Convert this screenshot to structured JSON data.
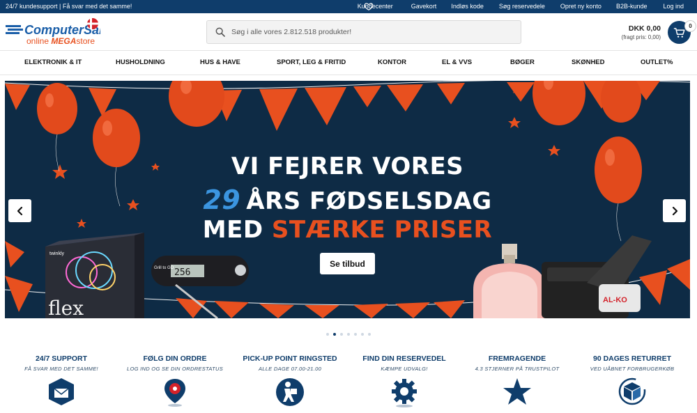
{
  "topbar": {
    "promo": "24/7 kundesupport | Få svar med det samme!",
    "links": [
      "Kundecenter",
      "Gavekort",
      "Indløs kode",
      "Søg reservedele",
      "Opret ny konto",
      "B2B-kunde",
      "Log ind"
    ]
  },
  "logo": {
    "line1": "ComputerSalg",
    "line2a": "online ",
    "line2b": "MEGA",
    "line2c": "store"
  },
  "search": {
    "placeholder": "Søg i alle vores 2.812.518 produkter!"
  },
  "cart": {
    "amount": "DKK 0,00",
    "shipping": "(fragt pris: 0,00)",
    "count": "0"
  },
  "nav": [
    "ELEKTRONIK & IT",
    "HUSHOLDNING",
    "HUS & HAVE",
    "SPORT, LEG & FRITID",
    "KONTOR",
    "EL & VVS",
    "BØGER",
    "SKØNHED",
    "OUTLET%"
  ],
  "hero": {
    "line1": "VI FEJRER VORES",
    "age": "29",
    "line2": "ÅRS FØDSELSDAG",
    "line3a": "MED ",
    "line3b": "STÆRKE PRISER",
    "cta": "Se tilbud",
    "product_flex": "flex",
    "product_brand": "twinkly",
    "thermo": "256",
    "thermo_brand": "Grill to GO",
    "drill_brand": "AL-KO"
  },
  "carousel": {
    "slides": 7,
    "active": 2
  },
  "usps": [
    {
      "title": "24/7 SUPPORT",
      "sub": "FÅ SVAR MED DET SAMME!",
      "icon": "support-envelope-icon"
    },
    {
      "title": "FØLG DIN ORDRE",
      "sub": "LOG IND OG SE DIN ORDRESTATUS",
      "icon": "location-pin-icon"
    },
    {
      "title": "PICK-UP POINT RINGSTED",
      "sub": "ALLE DAGE 07.00-21.00",
      "icon": "delivery-person-icon"
    },
    {
      "title": "FIND DIN RESERVEDEL",
      "sub": "KÆMPE UDVALG!",
      "icon": "gear-icon"
    },
    {
      "title": "FREMRAGENDE",
      "sub": "4.3 STJERNER PÅ TRUSTPILOT",
      "icon": "star-icon"
    },
    {
      "title": "90 DAGES RETURRET",
      "sub": "VED UÅBNET FORBRUGERKØB",
      "icon": "return-box-icon"
    }
  ],
  "colors": {
    "brand": "#0f3d6b",
    "accent": "#e8501f",
    "hero_bg": "#0e2b45",
    "blue_text": "#3b95e0"
  }
}
